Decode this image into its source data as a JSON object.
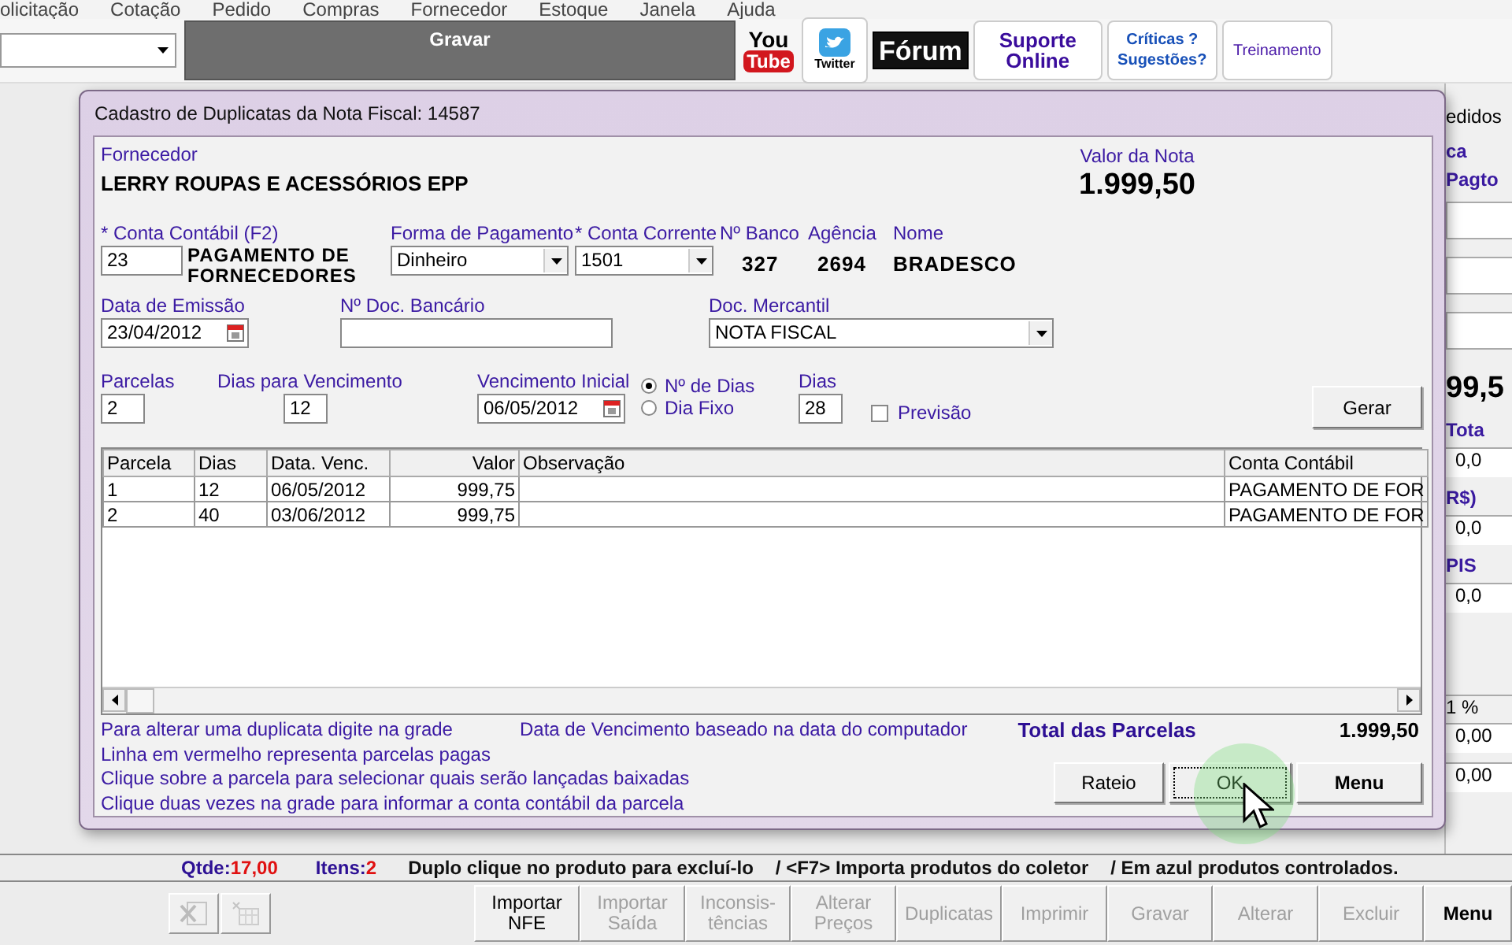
{
  "menu_bar": [
    "olicitação",
    "Cotação",
    "Pedido",
    "Compras",
    "Fornecedor",
    "Estoque",
    "Janela",
    "Ajuda"
  ],
  "toolbar": {
    "save_label": "Gravar",
    "links": [
      {
        "kind": "youtube",
        "lines": [
          "You",
          "Tube"
        ]
      },
      {
        "kind": "twitter",
        "lines": [
          "Twitter"
        ]
      },
      {
        "kind": "forum",
        "lines": [
          "Fórum"
        ]
      },
      {
        "kind": "support",
        "lines": [
          "Suporte",
          "Online"
        ]
      },
      {
        "kind": "feedback",
        "lines": [
          "Críticas ?",
          "Sugestões?"
        ]
      },
      {
        "kind": "training",
        "lines": [
          "Treinamento"
        ]
      }
    ]
  },
  "side_panel": [
    {
      "kind": "tab",
      "text": "edidos"
    },
    {
      "kind": "label",
      "text": "ca"
    },
    {
      "kind": "label",
      "text": "Pagto"
    },
    {
      "kind": "field"
    },
    {
      "kind": "field"
    },
    {
      "kind": "field"
    },
    {
      "kind": "total",
      "text": "99,5"
    },
    {
      "kind": "label",
      "text": "Tota"
    },
    {
      "kind": "value",
      "text": "0,0"
    },
    {
      "kind": "label",
      "text": "R$)"
    },
    {
      "kind": "value",
      "text": "0,0"
    },
    {
      "kind": "label",
      "text": "PIS"
    },
    {
      "kind": "value",
      "text": "0,0"
    },
    {
      "kind": "header",
      "text": "1 %"
    },
    {
      "kind": "value",
      "text": "0,00"
    },
    {
      "kind": "value",
      "text": "0,00"
    }
  ],
  "dialog": {
    "title": "Cadastro de Duplicatas da Nota Fiscal: 14587",
    "supplier": {
      "label": "Fornecedor",
      "value": "LERRY ROUPAS E ACESSÓRIOS EPP"
    },
    "invoice_total": {
      "label": "Valor da Nota",
      "value": "1.999,50"
    },
    "account": {
      "label": "* Conta Contábil (F2)",
      "value": "23",
      "description": "PAGAMENTO DE FORNECEDORES"
    },
    "payment_method": {
      "label": "Forma de Pagamento",
      "value": "Dinheiro"
    },
    "checking_account": {
      "label": "* Conta Corrente",
      "value": "1501"
    },
    "bank_number": {
      "label": "Nº Banco",
      "value": "327"
    },
    "agency": {
      "label": "Agência",
      "value": "2694"
    },
    "bank_name": {
      "label": "Nome",
      "value": "BRADESCO"
    },
    "issue_date": {
      "label": "Data de Emissão",
      "value": "23/04/2012"
    },
    "bank_doc": {
      "label": "Nº Doc. Bancário"
    },
    "doc_type": {
      "label": "Doc. Mercantil",
      "value": "NOTA FISCAL"
    },
    "installments": {
      "label": "Parcelas",
      "value": "2"
    },
    "days_to_due": {
      "label": "Dias para Vencimento",
      "value": "12"
    },
    "first_due": {
      "label": "Vencimento Inicial",
      "value": "06/05/2012"
    },
    "due_mode": [
      {
        "label": "Nº de Dias",
        "selected": true
      },
      {
        "label": "Dia Fixo",
        "selected": false
      }
    ],
    "days": {
      "label": "Dias",
      "value": "28"
    },
    "forecast": {
      "label": "Previsão",
      "checked": false
    },
    "generate_button": "Gerar",
    "grid": {
      "columns": [
        "Parcela",
        "Dias",
        "Data. Venc.",
        "Valor",
        "Observação",
        "Conta Contábil"
      ],
      "rows": [
        [
          "1",
          "12",
          "06/05/2012",
          "999,75",
          "",
          "PAGAMENTO DE FOR"
        ],
        [
          "2",
          "40",
          "03/06/2012",
          "999,75",
          "",
          "PAGAMENTO DE FOR"
        ]
      ]
    },
    "notes": [
      "Para alterar uma duplicata digite na grade",
      "Linha em vermelho representa parcelas pagas",
      "Clique sobre a parcela para selecionar quais serão lançadas baixadas",
      "Clique duas vezes na grade para informar a conta contábil da parcela"
    ],
    "date_note": "Data de Vencimento baseado na data do computador",
    "total": {
      "label": "Total das Parcelas",
      "value": "1.999,50"
    },
    "buttons": [
      {
        "label": "Rateio",
        "focused": false,
        "bold": false
      },
      {
        "label": "OK",
        "focused": true,
        "bold": false
      },
      {
        "label": "Menu",
        "focused": false,
        "bold": true
      }
    ]
  },
  "status": {
    "qty_label": "Qtde:",
    "qty": "17,00",
    "items_label": "Itens:",
    "items": "2",
    "hints": [
      "Duplo clique no produto para excluí-lo",
      "/ <F7> Importa produtos do coletor",
      "/ Em azul produtos controlados."
    ]
  },
  "bottom_buttons": [
    {
      "kind": "excel",
      "disabled": true
    },
    {
      "kind": "table",
      "disabled": true
    },
    {
      "kind": "text",
      "lines": [
        "Importar",
        "NFE"
      ],
      "disabled": false
    },
    {
      "kind": "text",
      "lines": [
        "Importar",
        "Saída"
      ],
      "disabled": true
    },
    {
      "kind": "text",
      "lines": [
        "Inconsis-",
        "tências"
      ],
      "disabled": true
    },
    {
      "kind": "text",
      "lines": [
        "Alterar",
        "Preços"
      ],
      "disabled": true
    },
    {
      "kind": "text",
      "lines": [
        "Duplicatas"
      ],
      "disabled": true
    },
    {
      "kind": "text",
      "lines": [
        "Imprimir"
      ],
      "disabled": true
    },
    {
      "kind": "text",
      "lines": [
        "Gravar"
      ],
      "disabled": true
    },
    {
      "kind": "text",
      "lines": [
        "Alterar"
      ],
      "disabled": true
    },
    {
      "kind": "text",
      "lines": [
        "Excluir"
      ],
      "disabled": true
    },
    {
      "kind": "text",
      "lines": [
        "Menu"
      ],
      "disabled": false
    }
  ]
}
